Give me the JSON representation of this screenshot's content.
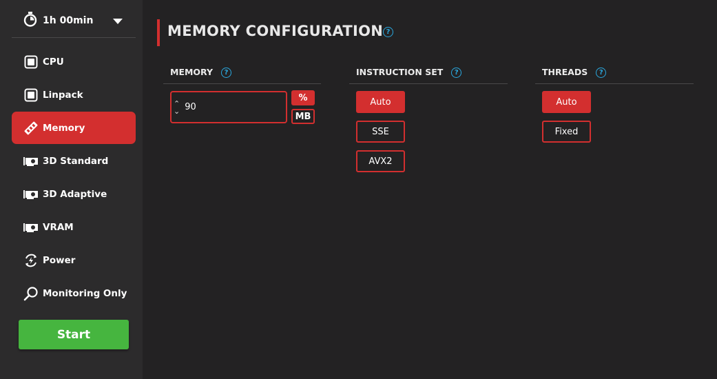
{
  "sidebar": {
    "timer": {
      "label": "1h 00min",
      "icon": "stopwatch-icon",
      "caret": "chevron-down-icon"
    },
    "items": [
      {
        "label": "CPU",
        "icon": "cpu-chip-icon",
        "active": false
      },
      {
        "label": "Linpack",
        "icon": "cpu-chip-icon",
        "active": false
      },
      {
        "label": "Memory",
        "icon": "ram-stick-icon",
        "active": true
      },
      {
        "label": "3D Standard",
        "icon": "gpu-card-icon",
        "active": false
      },
      {
        "label": "3D Adaptive",
        "icon": "gpu-card-icon",
        "active": false
      },
      {
        "label": "VRAM",
        "icon": "gpu-card-icon",
        "active": false
      },
      {
        "label": "Power",
        "icon": "power-cycle-icon",
        "active": false
      },
      {
        "label": "Monitoring Only",
        "icon": "magnifier-icon",
        "active": false
      }
    ],
    "start_label": "Start"
  },
  "main": {
    "title": "MEMORY CONFIGURATION",
    "help_icon": "help-icon",
    "memory": {
      "label": "MEMORY",
      "value": "90",
      "units": [
        {
          "label": "%",
          "active": true
        },
        {
          "label": "MB",
          "active": false
        }
      ]
    },
    "instruction_set": {
      "label": "INSTRUCTION SET",
      "options": [
        {
          "label": "Auto",
          "active": true
        },
        {
          "label": "SSE",
          "active": false
        },
        {
          "label": "AVX2",
          "active": false
        }
      ]
    },
    "threads": {
      "label": "THREADS",
      "options": [
        {
          "label": "Auto",
          "active": true
        },
        {
          "label": "Fixed",
          "active": false
        }
      ]
    }
  },
  "colors": {
    "accent": "#d32f2f",
    "start": "#46b53f",
    "help": "#2aa9e0",
    "sidebar_bg": "#2c2b2c",
    "main_bg": "#232223"
  }
}
